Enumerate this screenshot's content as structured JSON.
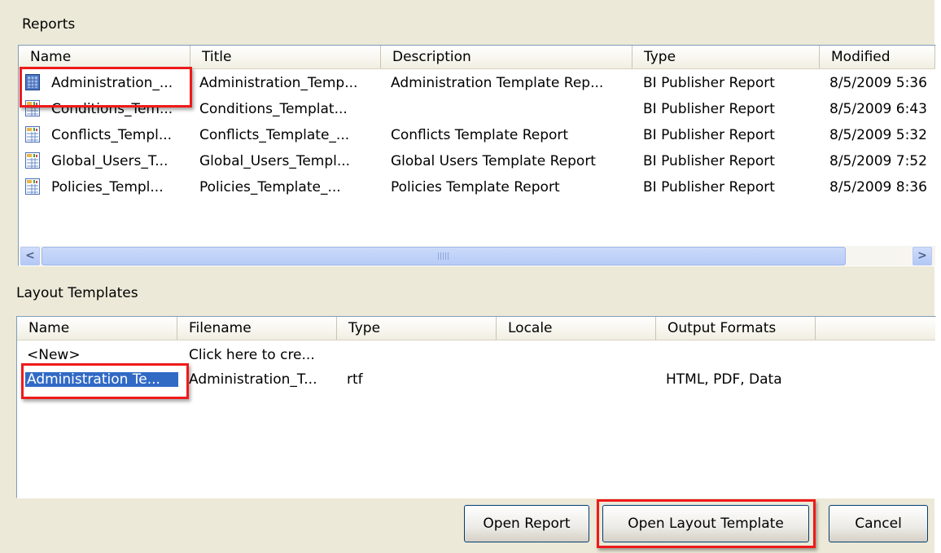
{
  "reports": {
    "label": "Reports",
    "columns": [
      "Name",
      "Title",
      "Description",
      "Type",
      "Modified"
    ],
    "rows": [
      {
        "name": "Administration_...",
        "title": "Administration_Temp...",
        "description": "Administration Template Rep...",
        "type": "BI Publisher Report",
        "modified": "8/5/2009 5:36",
        "icon": "report-selected-icon"
      },
      {
        "name": "Conditions_Tem...",
        "title": "Conditions_Templat...",
        "description": "",
        "type": "BI Publisher Report",
        "modified": "8/5/2009 6:43",
        "icon": "report-icon"
      },
      {
        "name": "Conflicts_Templ...",
        "title": "Conflicts_Template_...",
        "description": "Conflicts Template Report",
        "type": "BI Publisher Report",
        "modified": "8/5/2009 5:32",
        "icon": "report-icon"
      },
      {
        "name": "Global_Users_T...",
        "title": "Global_Users_Templ...",
        "description": "Global Users Template Report",
        "type": "BI Publisher Report",
        "modified": "8/5/2009 7:52",
        "icon": "report-icon"
      },
      {
        "name": "Policies_Templ...",
        "title": "Policies_Template_...",
        "description": "Policies Template Report",
        "type": "BI Publisher Report",
        "modified": "8/5/2009 8:36",
        "icon": "report-icon"
      }
    ],
    "scroll_left": "<",
    "scroll_right": ">"
  },
  "layout_templates": {
    "label": "Layout Templates",
    "columns": [
      "Name",
      "Filename",
      "Type",
      "Locale",
      "Output Formats"
    ],
    "rows": [
      {
        "name": "<New>",
        "filename": "Click here to cre...",
        "type": "",
        "locale": "",
        "output_formats": ""
      },
      {
        "name": "Administration Te...",
        "filename": "Administration_T...",
        "type": "rtf",
        "locale": "",
        "output_formats": "HTML, PDF, Data"
      }
    ]
  },
  "buttons": {
    "open_report": "Open Report",
    "open_layout_template": "Open Layout Template",
    "cancel": "Cancel"
  },
  "colors": {
    "dialog_bg": "#ece9d8",
    "selection": "#316ac5",
    "annotation_red": "#ef1a1a"
  }
}
